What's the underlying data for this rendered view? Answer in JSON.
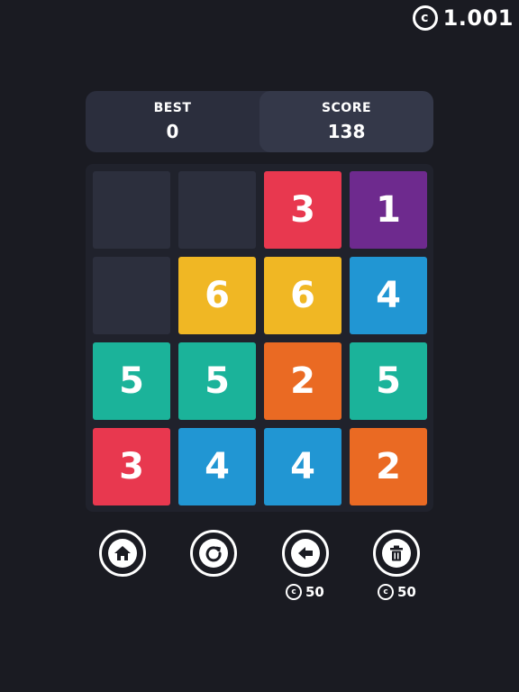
{
  "coins": {
    "symbol": "c",
    "amount": "1.001"
  },
  "scoreboard": {
    "best_label": "BEST",
    "best_value": "0",
    "score_label": "SCORE",
    "score_value": "138"
  },
  "board": {
    "empty_color": "#2c2f3d",
    "colors": {
      "1": "#6e2a8e",
      "2": "#ea6a23",
      "3": "#e8384f",
      "4": "#2196d3",
      "5": "#1bb39a",
      "6": "#f0b724"
    },
    "rows": [
      [
        "",
        "",
        "3",
        "1"
      ],
      [
        "",
        "6",
        "6",
        "4"
      ],
      [
        "5",
        "5",
        "2",
        "5"
      ],
      [
        "3",
        "4",
        "4",
        "2"
      ]
    ]
  },
  "controls": {
    "home": {
      "icon": "home-icon"
    },
    "restart": {
      "icon": "restart-icon"
    },
    "undo": {
      "icon": "arrow-left-icon",
      "cost": "50"
    },
    "trash": {
      "icon": "trash-icon",
      "cost": "50"
    }
  }
}
